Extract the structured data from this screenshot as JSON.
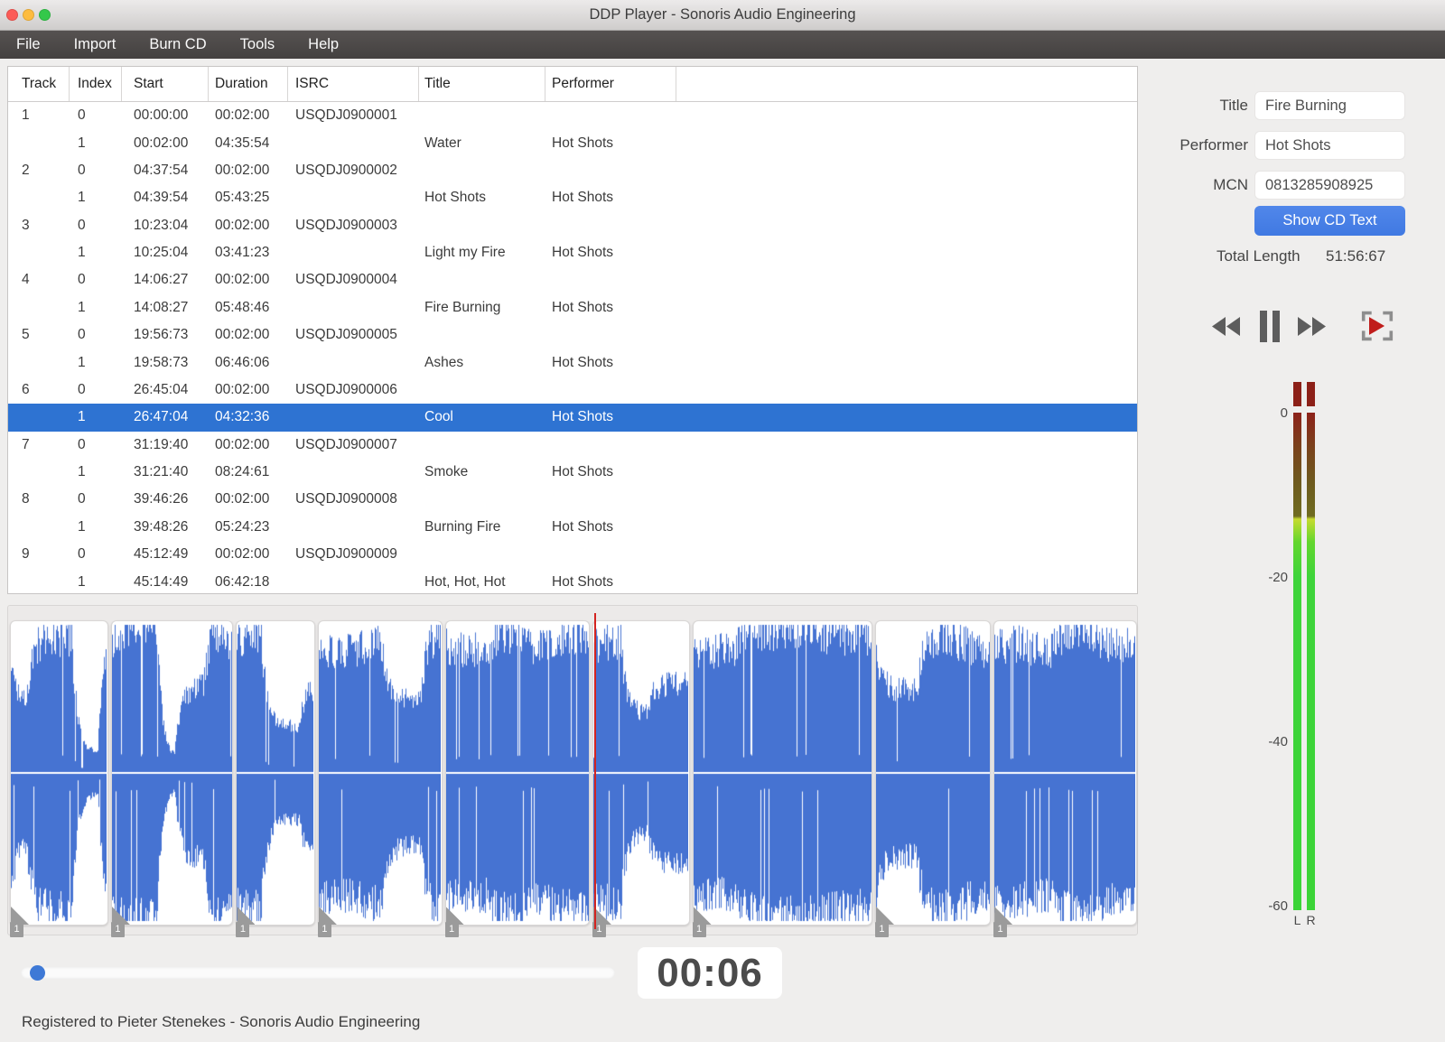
{
  "window": {
    "title": "DDP Player - Sonoris Audio Engineering"
  },
  "menu": {
    "items": [
      "File",
      "Import",
      "Burn CD",
      "Tools",
      "Help"
    ]
  },
  "track_list": {
    "columns": [
      "Track",
      "Index",
      "Start",
      "Duration",
      "ISRC",
      "Title",
      "Performer"
    ],
    "rows": [
      {
        "track": "1",
        "index": "0",
        "start": "00:00:00",
        "duration": "00:02:00",
        "isrc": "USQDJ0900001",
        "title": "",
        "performer": "",
        "selected": false
      },
      {
        "track": "",
        "index": "1",
        "start": "00:02:00",
        "duration": "04:35:54",
        "isrc": "",
        "title": "Water",
        "performer": "Hot Shots",
        "selected": false
      },
      {
        "track": "2",
        "index": "0",
        "start": "04:37:54",
        "duration": "00:02:00",
        "isrc": "USQDJ0900002",
        "title": "",
        "performer": "",
        "selected": false
      },
      {
        "track": "",
        "index": "1",
        "start": "04:39:54",
        "duration": "05:43:25",
        "isrc": "",
        "title": "Hot Shots",
        "performer": "Hot Shots",
        "selected": false
      },
      {
        "track": "3",
        "index": "0",
        "start": "10:23:04",
        "duration": "00:02:00",
        "isrc": "USQDJ0900003",
        "title": "",
        "performer": "",
        "selected": false
      },
      {
        "track": "",
        "index": "1",
        "start": "10:25:04",
        "duration": "03:41:23",
        "isrc": "",
        "title": "Light my Fire",
        "performer": "Hot Shots",
        "selected": false
      },
      {
        "track": "4",
        "index": "0",
        "start": "14:06:27",
        "duration": "00:02:00",
        "isrc": "USQDJ0900004",
        "title": "",
        "performer": "",
        "selected": false
      },
      {
        "track": "",
        "index": "1",
        "start": "14:08:27",
        "duration": "05:48:46",
        "isrc": "",
        "title": "Fire Burning",
        "performer": "Hot Shots",
        "selected": false
      },
      {
        "track": "5",
        "index": "0",
        "start": "19:56:73",
        "duration": "00:02:00",
        "isrc": "USQDJ0900005",
        "title": "",
        "performer": "",
        "selected": false
      },
      {
        "track": "",
        "index": "1",
        "start": "19:58:73",
        "duration": "06:46:06",
        "isrc": "",
        "title": "Ashes",
        "performer": "Hot Shots",
        "selected": false
      },
      {
        "track": "6",
        "index": "0",
        "start": "26:45:04",
        "duration": "00:02:00",
        "isrc": "USQDJ0900006",
        "title": "",
        "performer": "",
        "selected": false
      },
      {
        "track": "",
        "index": "1",
        "start": "26:47:04",
        "duration": "04:32:36",
        "isrc": "",
        "title": "Cool",
        "performer": "Hot Shots",
        "selected": true
      },
      {
        "track": "7",
        "index": "0",
        "start": "31:19:40",
        "duration": "00:02:00",
        "isrc": "USQDJ0900007",
        "title": "",
        "performer": "",
        "selected": false
      },
      {
        "track": "",
        "index": "1",
        "start": "31:21:40",
        "duration": "08:24:61",
        "isrc": "",
        "title": "Smoke",
        "performer": "Hot Shots",
        "selected": false
      },
      {
        "track": "8",
        "index": "0",
        "start": "39:46:26",
        "duration": "00:02:00",
        "isrc": "USQDJ0900008",
        "title": "",
        "performer": "",
        "selected": false
      },
      {
        "track": "",
        "index": "1",
        "start": "39:48:26",
        "duration": "05:24:23",
        "isrc": "",
        "title": "Burning Fire",
        "performer": "Hot Shots",
        "selected": false
      },
      {
        "track": "9",
        "index": "0",
        "start": "45:12:49",
        "duration": "00:02:00",
        "isrc": "USQDJ0900009",
        "title": "",
        "performer": "",
        "selected": false
      },
      {
        "track": "",
        "index": "1",
        "start": "45:14:49",
        "duration": "06:42:18",
        "isrc": "",
        "title": "Hot, Hot, Hot",
        "performer": "Hot Shots",
        "selected": false
      }
    ]
  },
  "cd_text": {
    "title_label": "Title",
    "title_value": "Fire Burning",
    "performer_label": "Performer",
    "performer_value": "Hot Shots",
    "mcn_label": "MCN",
    "mcn_value": "0813285908925",
    "show_cd_text_button": "Show CD Text",
    "total_length_label": "Total Length",
    "total_length_value": "51:56:67"
  },
  "transport": {
    "buttons": [
      "rewind",
      "pause",
      "fast-forward",
      "play-to-marker"
    ]
  },
  "level_meter": {
    "scale_labels": [
      "0",
      "-20",
      "-40",
      "-60"
    ],
    "channel_labels": [
      "L",
      "R"
    ]
  },
  "waveform": {
    "marker_label": "1",
    "tracks": [
      {
        "number": 1,
        "duration": "04:35:54",
        "duration_sec": 275.7
      },
      {
        "number": 2,
        "duration": "05:43:25",
        "duration_sec": 343.3
      },
      {
        "number": 3,
        "duration": "03:41:23",
        "duration_sec": 221.3
      },
      {
        "number": 4,
        "duration": "05:48:46",
        "duration_sec": 348.6
      },
      {
        "number": 5,
        "duration": "06:46:06",
        "duration_sec": 406.1
      },
      {
        "number": 6,
        "duration": "04:32:36",
        "duration_sec": 272.5
      },
      {
        "number": 7,
        "duration": "08:24:61",
        "duration_sec": 504.8
      },
      {
        "number": 8,
        "duration": "05:24:23",
        "duration_sec": 324.3
      },
      {
        "number": 9,
        "duration": "06:42:18",
        "duration_sec": 402.2
      }
    ],
    "playhead_track": 6,
    "playhead_offset_sec": 6
  },
  "time_display": "00:06",
  "status_bar": "Registered to Pieter Stenekes - Sonoris Audio Engineering",
  "colors": {
    "selection": "#2e73d2",
    "accent_button": "#4a80e4",
    "waveform": "#4673d2",
    "playhead": "#d32420",
    "meter_green": "#3ed43a",
    "meter_clip": "#8c2018"
  }
}
